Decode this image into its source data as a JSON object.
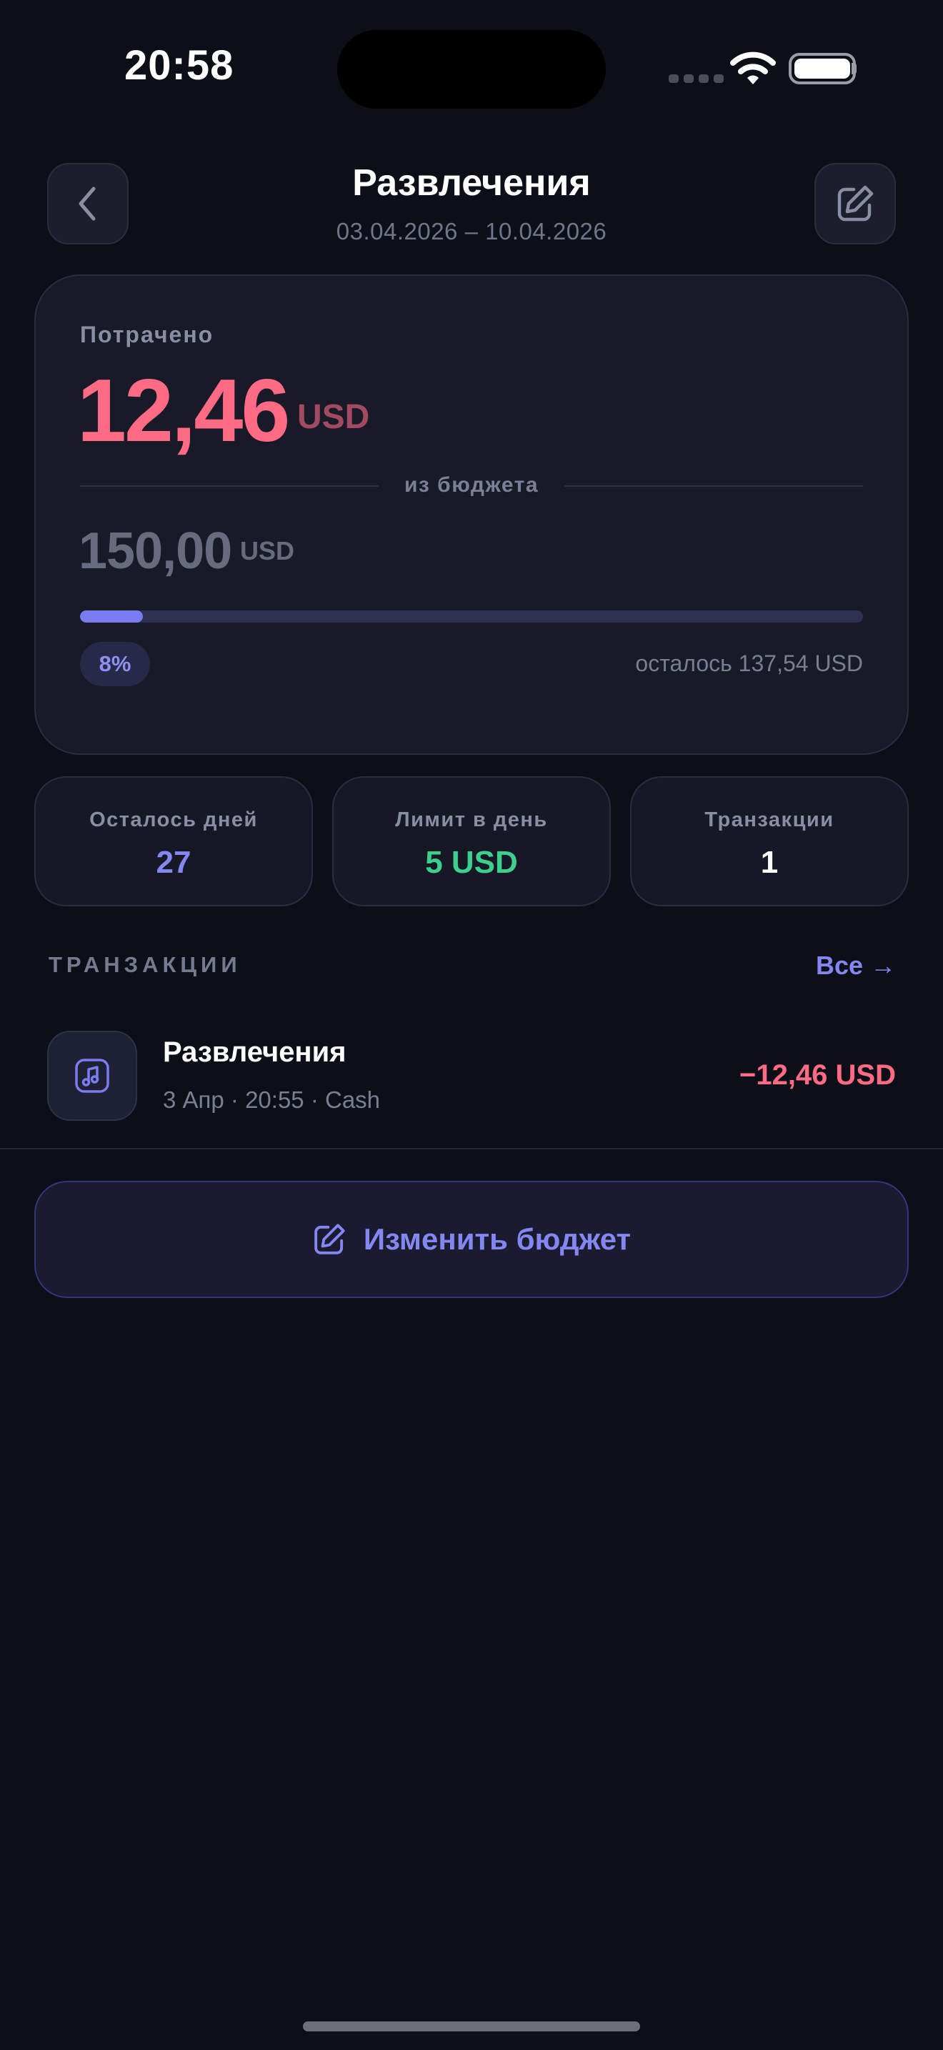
{
  "status_bar": {
    "time": "20:58"
  },
  "header": {
    "title": "Развлечения",
    "dates": "03.04.2026 – 10.04.2026",
    "back_icon": "chevron-left-icon",
    "edit_icon": "edit-icon"
  },
  "summary": {
    "spent_label": "Потрачено",
    "spent_value": "12,46",
    "spent_currency": "USD",
    "divider_text": "из бюджета",
    "budget_value": "150,00",
    "budget_currency": "USD",
    "progress_percent": 8,
    "progress_label": "8%",
    "remaining_text": "осталось 137,54 USD"
  },
  "stats": [
    {
      "label": "Осталось дней",
      "value": "27",
      "color": "#8587f0"
    },
    {
      "label": "Лимит в день",
      "value": "5 USD",
      "color": "#3ccf8e"
    },
    {
      "label": "Транзакции",
      "value": "1",
      "color": "#ffffff"
    }
  ],
  "transactions_section": {
    "title": "ТРАНЗАКЦИИ",
    "see_all": "Все →",
    "items": [
      {
        "name": "Развлечения",
        "meta": "3 Апр · 20:55 · Cash",
        "amount": "−12,46 USD",
        "icon": "music-icon"
      }
    ]
  },
  "action": {
    "label": "Изменить бюджет",
    "icon": "edit-icon"
  },
  "colors": {
    "background": "#0d0f18",
    "accent": "#8587f0",
    "expense": "#ff6b85",
    "positive": "#3ccf8e"
  }
}
